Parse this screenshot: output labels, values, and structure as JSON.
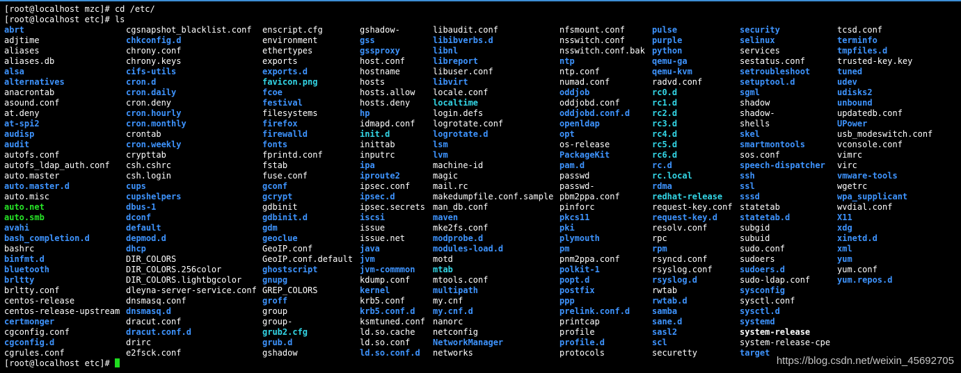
{
  "terminal": {
    "line1": "[root@localhost mzc]# cd /etc/",
    "line2": "[root@localhost etc]# ls",
    "final_prompt": "[root@localhost etc]# ",
    "colors": {
      "background": "#000000",
      "plain": "#ffffff",
      "directory": "#3e94ff",
      "symlink": "#33d6e6",
      "executable": "#27e527",
      "cursor": "#1fdc1f",
      "top_border": "#3d8fd6"
    }
  },
  "watermark": "https://blog.csdn.net/weixin_45692705",
  "ls_columns": [
    [
      {
        "name": "abrt",
        "type": "dir"
      },
      {
        "name": "adjtime",
        "type": "plain"
      },
      {
        "name": "aliases",
        "type": "plain"
      },
      {
        "name": "aliases.db",
        "type": "plain"
      },
      {
        "name": "alsa",
        "type": "dir"
      },
      {
        "name": "alternatives",
        "type": "dir"
      },
      {
        "name": "anacrontab",
        "type": "plain"
      },
      {
        "name": "asound.conf",
        "type": "plain"
      },
      {
        "name": "at.deny",
        "type": "plain"
      },
      {
        "name": "at-spi2",
        "type": "dir"
      },
      {
        "name": "audisp",
        "type": "dir"
      },
      {
        "name": "audit",
        "type": "dir"
      },
      {
        "name": "autofs.conf",
        "type": "plain"
      },
      {
        "name": "autofs_ldap_auth.conf",
        "type": "plain"
      },
      {
        "name": "auto.master",
        "type": "plain"
      },
      {
        "name": "auto.master.d",
        "type": "dir"
      },
      {
        "name": "auto.misc",
        "type": "plain"
      },
      {
        "name": "auto.net",
        "type": "exec"
      },
      {
        "name": "auto.smb",
        "type": "exec"
      },
      {
        "name": "avahi",
        "type": "dir"
      },
      {
        "name": "bash_completion.d",
        "type": "dir"
      },
      {
        "name": "bashrc",
        "type": "plain"
      },
      {
        "name": "binfmt.d",
        "type": "dir"
      },
      {
        "name": "bluetooth",
        "type": "dir"
      },
      {
        "name": "brltty",
        "type": "dir"
      },
      {
        "name": "brltty.conf",
        "type": "plain"
      },
      {
        "name": "centos-release",
        "type": "plain"
      },
      {
        "name": "centos-release-upstream",
        "type": "plain"
      },
      {
        "name": "certmonger",
        "type": "dir"
      },
      {
        "name": "cgconfig.conf",
        "type": "plain"
      },
      {
        "name": "cgconfig.d",
        "type": "dir"
      },
      {
        "name": "cgrules.conf",
        "type": "plain"
      }
    ],
    [
      {
        "name": "cgsnapshot_blacklist.conf",
        "type": "plain"
      },
      {
        "name": "chkconfig.d",
        "type": "dir"
      },
      {
        "name": "chrony.conf",
        "type": "plain"
      },
      {
        "name": "chrony.keys",
        "type": "plain"
      },
      {
        "name": "cifs-utils",
        "type": "dir"
      },
      {
        "name": "cron.d",
        "type": "dir"
      },
      {
        "name": "cron.daily",
        "type": "dir"
      },
      {
        "name": "cron.deny",
        "type": "plain"
      },
      {
        "name": "cron.hourly",
        "type": "dir"
      },
      {
        "name": "cron.monthly",
        "type": "dir"
      },
      {
        "name": "crontab",
        "type": "plain"
      },
      {
        "name": "cron.weekly",
        "type": "dir"
      },
      {
        "name": "crypttab",
        "type": "plain"
      },
      {
        "name": "csh.cshrc",
        "type": "plain"
      },
      {
        "name": "csh.login",
        "type": "plain"
      },
      {
        "name": "cups",
        "type": "dir"
      },
      {
        "name": "cupshelpers",
        "type": "dir"
      },
      {
        "name": "dbus-1",
        "type": "dir"
      },
      {
        "name": "dconf",
        "type": "dir"
      },
      {
        "name": "default",
        "type": "dir"
      },
      {
        "name": "depmod.d",
        "type": "dir"
      },
      {
        "name": "dhcp",
        "type": "dir"
      },
      {
        "name": "DIR_COLORS",
        "type": "plain"
      },
      {
        "name": "DIR_COLORS.256color",
        "type": "plain"
      },
      {
        "name": "DIR_COLORS.lightbgcolor",
        "type": "plain"
      },
      {
        "name": "dleyna-server-service.conf",
        "type": "plain"
      },
      {
        "name": "dnsmasq.conf",
        "type": "plain"
      },
      {
        "name": "dnsmasq.d",
        "type": "dir"
      },
      {
        "name": "dracut.conf",
        "type": "plain"
      },
      {
        "name": "dracut.conf.d",
        "type": "dir"
      },
      {
        "name": "drirc",
        "type": "plain"
      },
      {
        "name": "e2fsck.conf",
        "type": "plain"
      }
    ],
    [
      {
        "name": "enscript.cfg",
        "type": "plain"
      },
      {
        "name": "environment",
        "type": "plain"
      },
      {
        "name": "ethertypes",
        "type": "plain"
      },
      {
        "name": "exports",
        "type": "plain"
      },
      {
        "name": "exports.d",
        "type": "dir"
      },
      {
        "name": "favicon.png",
        "type": "link"
      },
      {
        "name": "fcoe",
        "type": "dir"
      },
      {
        "name": "festival",
        "type": "dir"
      },
      {
        "name": "filesystems",
        "type": "plain"
      },
      {
        "name": "firefox",
        "type": "dir"
      },
      {
        "name": "firewalld",
        "type": "dir"
      },
      {
        "name": "fonts",
        "type": "dir"
      },
      {
        "name": "fprintd.conf",
        "type": "plain"
      },
      {
        "name": "fstab",
        "type": "plain"
      },
      {
        "name": "fuse.conf",
        "type": "plain"
      },
      {
        "name": "gconf",
        "type": "dir"
      },
      {
        "name": "gcrypt",
        "type": "dir"
      },
      {
        "name": "gdbinit",
        "type": "plain"
      },
      {
        "name": "gdbinit.d",
        "type": "dir"
      },
      {
        "name": "gdm",
        "type": "dir"
      },
      {
        "name": "geoclue",
        "type": "dir"
      },
      {
        "name": "GeoIP.conf",
        "type": "plain"
      },
      {
        "name": "GeoIP.conf.default",
        "type": "plain"
      },
      {
        "name": "ghostscript",
        "type": "dir"
      },
      {
        "name": "gnupg",
        "type": "dir"
      },
      {
        "name": "GREP_COLORS",
        "type": "plain"
      },
      {
        "name": "groff",
        "type": "dir"
      },
      {
        "name": "group",
        "type": "plain"
      },
      {
        "name": "group-",
        "type": "plain"
      },
      {
        "name": "grub2.cfg",
        "type": "link"
      },
      {
        "name": "grub.d",
        "type": "dir"
      },
      {
        "name": "gshadow",
        "type": "plain"
      }
    ],
    [
      {
        "name": "gshadow-",
        "type": "plain"
      },
      {
        "name": "gss",
        "type": "dir"
      },
      {
        "name": "gssproxy",
        "type": "dir"
      },
      {
        "name": "host.conf",
        "type": "plain"
      },
      {
        "name": "hostname",
        "type": "plain"
      },
      {
        "name": "hosts",
        "type": "plain"
      },
      {
        "name": "hosts.allow",
        "type": "plain"
      },
      {
        "name": "hosts.deny",
        "type": "plain"
      },
      {
        "name": "hp",
        "type": "dir"
      },
      {
        "name": "idmapd.conf",
        "type": "plain"
      },
      {
        "name": "init.d",
        "type": "link"
      },
      {
        "name": "inittab",
        "type": "plain"
      },
      {
        "name": "inputrc",
        "type": "plain"
      },
      {
        "name": "ipa",
        "type": "dir"
      },
      {
        "name": "iproute2",
        "type": "dir"
      },
      {
        "name": "ipsec.conf",
        "type": "plain"
      },
      {
        "name": "ipsec.d",
        "type": "dir"
      },
      {
        "name": "ipsec.secrets",
        "type": "plain"
      },
      {
        "name": "iscsi",
        "type": "dir"
      },
      {
        "name": "issue",
        "type": "plain"
      },
      {
        "name": "issue.net",
        "type": "plain"
      },
      {
        "name": "java",
        "type": "dir"
      },
      {
        "name": "jvm",
        "type": "dir"
      },
      {
        "name": "jvm-commmon",
        "type": "dir"
      },
      {
        "name": "kdump.conf",
        "type": "plain"
      },
      {
        "name": "kernel",
        "type": "dir"
      },
      {
        "name": "krb5.conf",
        "type": "plain"
      },
      {
        "name": "krb5.conf.d",
        "type": "dir"
      },
      {
        "name": "ksmtuned.conf",
        "type": "plain"
      },
      {
        "name": "ld.so.cache",
        "type": "plain"
      },
      {
        "name": "ld.so.conf",
        "type": "plain"
      },
      {
        "name": "ld.so.conf.d",
        "type": "dir"
      }
    ],
    [
      {
        "name": "libaudit.conf",
        "type": "plain"
      },
      {
        "name": "libibverbs.d",
        "type": "dir"
      },
      {
        "name": "libnl",
        "type": "dir"
      },
      {
        "name": "libreport",
        "type": "dir"
      },
      {
        "name": "libuser.conf",
        "type": "plain"
      },
      {
        "name": "libvirt",
        "type": "dir"
      },
      {
        "name": "locale.conf",
        "type": "plain"
      },
      {
        "name": "localtime",
        "type": "link"
      },
      {
        "name": "login.defs",
        "type": "plain"
      },
      {
        "name": "logrotate.conf",
        "type": "plain"
      },
      {
        "name": "logrotate.d",
        "type": "dir"
      },
      {
        "name": "lsm",
        "type": "dir"
      },
      {
        "name": "lvm",
        "type": "dir"
      },
      {
        "name": "machine-id",
        "type": "plain"
      },
      {
        "name": "magic",
        "type": "plain"
      },
      {
        "name": "mail.rc",
        "type": "plain"
      },
      {
        "name": "makedumpfile.conf.sample",
        "type": "plain"
      },
      {
        "name": "man_db.conf",
        "type": "plain"
      },
      {
        "name": "maven",
        "type": "dir"
      },
      {
        "name": "mke2fs.conf",
        "type": "plain"
      },
      {
        "name": "modprobe.d",
        "type": "dir"
      },
      {
        "name": "modules-load.d",
        "type": "dir"
      },
      {
        "name": "motd",
        "type": "plain"
      },
      {
        "name": "mtab",
        "type": "link"
      },
      {
        "name": "mtools.conf",
        "type": "plain"
      },
      {
        "name": "multipath",
        "type": "dir"
      },
      {
        "name": "my.cnf",
        "type": "plain"
      },
      {
        "name": "my.cnf.d",
        "type": "dir"
      },
      {
        "name": "nanorc",
        "type": "plain"
      },
      {
        "name": "netconfig",
        "type": "plain"
      },
      {
        "name": "NetworkManager",
        "type": "dir"
      },
      {
        "name": "networks",
        "type": "plain"
      }
    ],
    [
      {
        "name": "nfsmount.conf",
        "type": "plain"
      },
      {
        "name": "nsswitch.conf",
        "type": "plain"
      },
      {
        "name": "nsswitch.conf.bak",
        "type": "plain"
      },
      {
        "name": "ntp",
        "type": "dir"
      },
      {
        "name": "ntp.conf",
        "type": "plain"
      },
      {
        "name": "numad.conf",
        "type": "plain"
      },
      {
        "name": "oddjob",
        "type": "dir"
      },
      {
        "name": "oddjobd.conf",
        "type": "plain"
      },
      {
        "name": "oddjobd.conf.d",
        "type": "dir"
      },
      {
        "name": "openldap",
        "type": "dir"
      },
      {
        "name": "opt",
        "type": "dir"
      },
      {
        "name": "os-release",
        "type": "plain"
      },
      {
        "name": "PackageKit",
        "type": "dir"
      },
      {
        "name": "pam.d",
        "type": "dir"
      },
      {
        "name": "passwd",
        "type": "plain"
      },
      {
        "name": "passwd-",
        "type": "plain"
      },
      {
        "name": "pbm2ppa.conf",
        "type": "plain"
      },
      {
        "name": "pinforc",
        "type": "plain"
      },
      {
        "name": "pkcs11",
        "type": "dir"
      },
      {
        "name": "pki",
        "type": "dir"
      },
      {
        "name": "plymouth",
        "type": "dir"
      },
      {
        "name": "pm",
        "type": "dir"
      },
      {
        "name": "pnm2ppa.conf",
        "type": "plain"
      },
      {
        "name": "polkit-1",
        "type": "dir"
      },
      {
        "name": "popt.d",
        "type": "dir"
      },
      {
        "name": "postfix",
        "type": "dir"
      },
      {
        "name": "ppp",
        "type": "dir"
      },
      {
        "name": "prelink.conf.d",
        "type": "dir"
      },
      {
        "name": "printcap",
        "type": "plain"
      },
      {
        "name": "profile",
        "type": "plain"
      },
      {
        "name": "profile.d",
        "type": "dir"
      },
      {
        "name": "protocols",
        "type": "plain"
      }
    ],
    [
      {
        "name": "pulse",
        "type": "dir"
      },
      {
        "name": "purple",
        "type": "dir"
      },
      {
        "name": "python",
        "type": "dir"
      },
      {
        "name": "qemu-ga",
        "type": "dir"
      },
      {
        "name": "qemu-kvm",
        "type": "dir"
      },
      {
        "name": "radvd.conf",
        "type": "plain"
      },
      {
        "name": "rc0.d",
        "type": "link"
      },
      {
        "name": "rc1.d",
        "type": "link"
      },
      {
        "name": "rc2.d",
        "type": "link"
      },
      {
        "name": "rc3.d",
        "type": "link"
      },
      {
        "name": "rc4.d",
        "type": "link"
      },
      {
        "name": "rc5.d",
        "type": "link"
      },
      {
        "name": "rc6.d",
        "type": "link"
      },
      {
        "name": "rc.d",
        "type": "dir"
      },
      {
        "name": "rc.local",
        "type": "link"
      },
      {
        "name": "rdma",
        "type": "dir"
      },
      {
        "name": "redhat-release",
        "type": "link"
      },
      {
        "name": "request-key.conf",
        "type": "plain"
      },
      {
        "name": "request-key.d",
        "type": "dir"
      },
      {
        "name": "resolv.conf",
        "type": "plain"
      },
      {
        "name": "rpc",
        "type": "plain"
      },
      {
        "name": "rpm",
        "type": "dir"
      },
      {
        "name": "rsyncd.conf",
        "type": "plain"
      },
      {
        "name": "rsyslog.conf",
        "type": "plain"
      },
      {
        "name": "rsyslog.d",
        "type": "dir"
      },
      {
        "name": "rwtab",
        "type": "plain"
      },
      {
        "name": "rwtab.d",
        "type": "dir"
      },
      {
        "name": "samba",
        "type": "dir"
      },
      {
        "name": "sane.d",
        "type": "dir"
      },
      {
        "name": "sasl2",
        "type": "dir"
      },
      {
        "name": "scl",
        "type": "dir"
      },
      {
        "name": "securetty",
        "type": "plain"
      }
    ],
    [
      {
        "name": "security",
        "type": "dir"
      },
      {
        "name": "selinux",
        "type": "dir"
      },
      {
        "name": "services",
        "type": "plain"
      },
      {
        "name": "sestatus.conf",
        "type": "plain"
      },
      {
        "name": "setroubleshoot",
        "type": "dir"
      },
      {
        "name": "setuptool.d",
        "type": "dir"
      },
      {
        "name": "sgml",
        "type": "dir"
      },
      {
        "name": "shadow",
        "type": "plain"
      },
      {
        "name": "shadow-",
        "type": "plain"
      },
      {
        "name": "shells",
        "type": "plain"
      },
      {
        "name": "skel",
        "type": "dir"
      },
      {
        "name": "smartmontools",
        "type": "dir"
      },
      {
        "name": "sos.conf",
        "type": "plain"
      },
      {
        "name": "speech-dispatcher",
        "type": "dir"
      },
      {
        "name": "ssh",
        "type": "dir"
      },
      {
        "name": "ssl",
        "type": "dir"
      },
      {
        "name": "sssd",
        "type": "dir"
      },
      {
        "name": "statetab",
        "type": "plain"
      },
      {
        "name": "statetab.d",
        "type": "dir"
      },
      {
        "name": "subgid",
        "type": "plain"
      },
      {
        "name": "subuid",
        "type": "plain"
      },
      {
        "name": "sudo.conf",
        "type": "plain"
      },
      {
        "name": "sudoers",
        "type": "plain"
      },
      {
        "name": "sudoers.d",
        "type": "dir"
      },
      {
        "name": "sudo-ldap.conf",
        "type": "plain"
      },
      {
        "name": "sysconfig",
        "type": "dir"
      },
      {
        "name": "sysctl.conf",
        "type": "plain"
      },
      {
        "name": "sysctl.d",
        "type": "dir"
      },
      {
        "name": "systemd",
        "type": "dir"
      },
      {
        "name": "system-release",
        "type": "boldwhite"
      },
      {
        "name": "system-release-cpe",
        "type": "plain"
      },
      {
        "name": "target",
        "type": "dir"
      }
    ],
    [
      {
        "name": "tcsd.conf",
        "type": "plain"
      },
      {
        "name": "terminfo",
        "type": "dir"
      },
      {
        "name": "tmpfiles.d",
        "type": "dir"
      },
      {
        "name": "trusted-key.key",
        "type": "plain"
      },
      {
        "name": "tuned",
        "type": "dir"
      },
      {
        "name": "udev",
        "type": "dir"
      },
      {
        "name": "udisks2",
        "type": "dir"
      },
      {
        "name": "unbound",
        "type": "dir"
      },
      {
        "name": "updatedb.conf",
        "type": "plain"
      },
      {
        "name": "UPower",
        "type": "dir"
      },
      {
        "name": "usb_modeswitch.conf",
        "type": "plain"
      },
      {
        "name": "vconsole.conf",
        "type": "plain"
      },
      {
        "name": "vimrc",
        "type": "plain"
      },
      {
        "name": "virc",
        "type": "plain"
      },
      {
        "name": "vmware-tools",
        "type": "dir"
      },
      {
        "name": "wgetrc",
        "type": "plain"
      },
      {
        "name": "wpa_supplicant",
        "type": "dir"
      },
      {
        "name": "wvdial.conf",
        "type": "plain"
      },
      {
        "name": "X11",
        "type": "dir"
      },
      {
        "name": "xdg",
        "type": "dir"
      },
      {
        "name": "xinetd.d",
        "type": "dir"
      },
      {
        "name": "xml",
        "type": "dir"
      },
      {
        "name": "yum",
        "type": "dir"
      },
      {
        "name": "yum.conf",
        "type": "plain"
      },
      {
        "name": "yum.repos.d",
        "type": "dir"
      }
    ]
  ]
}
